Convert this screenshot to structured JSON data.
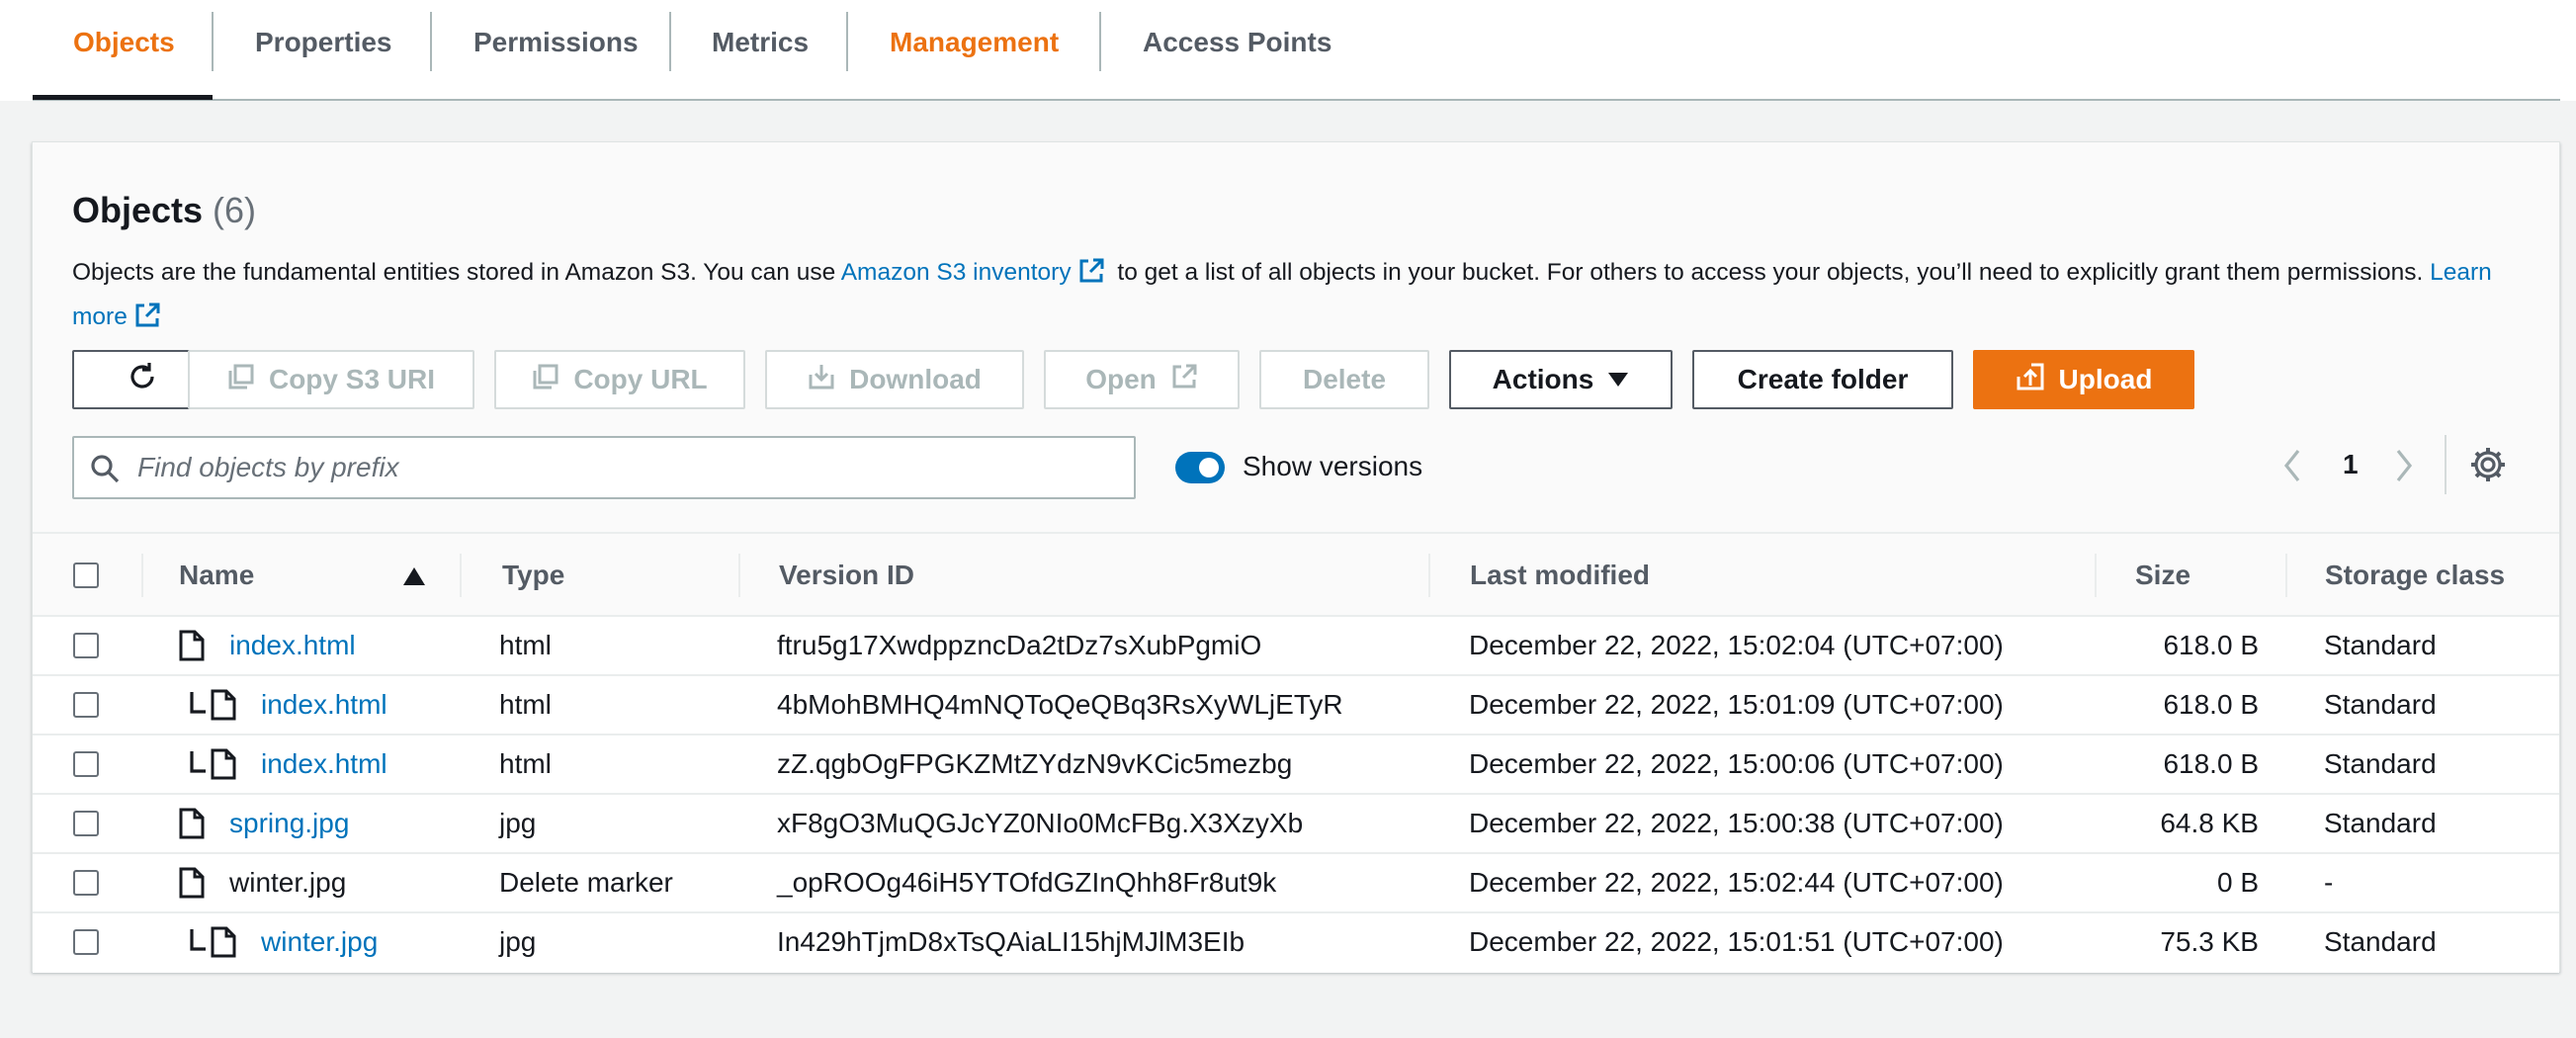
{
  "tabs": [
    {
      "label": "Objects"
    },
    {
      "label": "Properties"
    },
    {
      "label": "Permissions"
    },
    {
      "label": "Metrics"
    },
    {
      "label": "Management"
    },
    {
      "label": "Access Points"
    }
  ],
  "panel": {
    "title": "Objects",
    "count": "(6)",
    "desc_part1": "Objects are the fundamental entities stored in Amazon S3. You can use ",
    "desc_link1": "Amazon S3 inventory",
    "desc_part2": " to get a list of all objects in your bucket. For others to access your objects, you’ll need to explicitly grant them permissions. ",
    "desc_link2": "Learn more"
  },
  "toolbar": {
    "copy_s3_uri": "Copy S3 URI",
    "copy_url": "Copy URL",
    "download": "Download",
    "open": "Open",
    "delete": "Delete",
    "actions": "Actions",
    "create_folder": "Create folder",
    "upload": "Upload"
  },
  "search": {
    "placeholder": "Find objects by prefix",
    "value": ""
  },
  "show_versions": {
    "label": "Show versions",
    "enabled": true
  },
  "pager": {
    "page": "1"
  },
  "table": {
    "columns": [
      "Name",
      "Type",
      "Version ID",
      "Last modified",
      "Size",
      "Storage class"
    ],
    "rows": [
      {
        "name": "index.html",
        "type": "html",
        "version": "ftru5g17XwdppzncDa2tDz7sXubPgmiO",
        "modified": "December 22, 2022, 15:02:04 (UTC+07:00)",
        "size": "618.0 B",
        "storage": "Standard",
        "indent": false,
        "link": true
      },
      {
        "name": "index.html",
        "type": "html",
        "version": "4bMohBMHQ4mNQToQeQBq3RsXyWLjETyR",
        "modified": "December 22, 2022, 15:01:09 (UTC+07:00)",
        "size": "618.0 B",
        "storage": "Standard",
        "indent": true,
        "link": true
      },
      {
        "name": "index.html",
        "type": "html",
        "version": "zZ.qgbOgFPGKZMtZYdzN9vKCic5mezbg",
        "modified": "December 22, 2022, 15:00:06 (UTC+07:00)",
        "size": "618.0 B",
        "storage": "Standard",
        "indent": true,
        "link": true
      },
      {
        "name": "spring.jpg",
        "type": "jpg",
        "version": "xF8gO3MuQGJcYZ0NIo0McFBg.X3XzyXb",
        "modified": "December 22, 2022, 15:00:38 (UTC+07:00)",
        "size": "64.8 KB",
        "storage": "Standard",
        "indent": false,
        "link": true
      },
      {
        "name": "winter.jpg",
        "type": "Delete marker",
        "version": "_opROOg46iH5YTOfdGZInQhh8Fr8ut9k",
        "modified": "December 22, 2022, 15:02:44 (UTC+07:00)",
        "size": "0 B",
        "storage": "-",
        "indent": false,
        "link": false
      },
      {
        "name": "winter.jpg",
        "type": "jpg",
        "version": "In429hTjmD8xTsQAiaLI15hjMJlM3EIb",
        "modified": "December 22, 2022, 15:01:51 (UTC+07:00)",
        "size": "75.3 KB",
        "storage": "Standard",
        "indent": true,
        "link": true
      }
    ]
  },
  "colors": {
    "accent": "#ec7211",
    "link": "#0073bb",
    "toggle": "#0073bb"
  }
}
